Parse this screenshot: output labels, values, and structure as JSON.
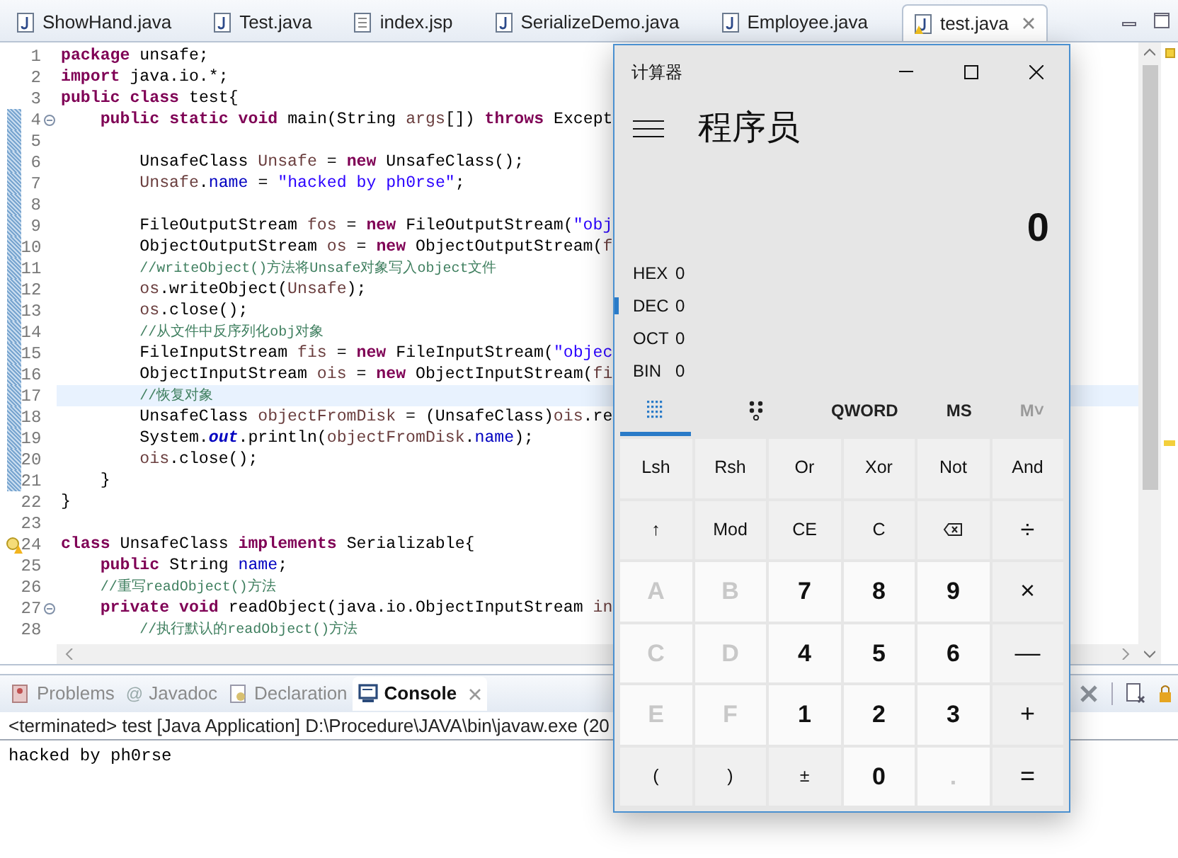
{
  "editor_tabs": [
    {
      "label": "ShowHand.java",
      "kind": "java",
      "selected": false,
      "warning": false
    },
    {
      "label": "Test.java",
      "kind": "java",
      "selected": false,
      "warning": false
    },
    {
      "label": "index.jsp",
      "kind": "jsp",
      "selected": false,
      "warning": false
    },
    {
      "label": "SerializeDemo.java",
      "kind": "java",
      "selected": false,
      "warning": false
    },
    {
      "label": "Employee.java",
      "kind": "java",
      "selected": false,
      "warning": false
    },
    {
      "label": "test.java",
      "kind": "java",
      "selected": true,
      "warning": true
    }
  ],
  "code_lines": [
    {
      "number": "1",
      "tokens": [
        {
          "text": "package",
          "kind": "k"
        },
        {
          "text": " unsafe;",
          "kind": "p"
        }
      ]
    },
    {
      "number": "2",
      "tokens": [
        {
          "text": "import",
          "kind": "k"
        },
        {
          "text": " java.io.*;",
          "kind": "p"
        }
      ]
    },
    {
      "number": "3",
      "tokens": [
        {
          "text": "public",
          "kind": "k"
        },
        {
          "text": " class",
          "kind": "k"
        },
        {
          "text": " test{",
          "kind": "p"
        }
      ]
    },
    {
      "number": "4",
      "fold": true,
      "changed": true,
      "tokens": [
        {
          "text": "    public",
          "kind": "k"
        },
        {
          "text": " static",
          "kind": "k"
        },
        {
          "text": " void",
          "kind": "k"
        },
        {
          "text": " main(String ",
          "kind": "p"
        },
        {
          "text": "args",
          "kind": "v"
        },
        {
          "text": "[]) ",
          "kind": "p"
        },
        {
          "text": "throws",
          "kind": "k"
        },
        {
          "text": " Except",
          "kind": "p"
        }
      ]
    },
    {
      "number": "5",
      "changed": true
    },
    {
      "number": "6",
      "changed": true,
      "tokens": [
        {
          "text": "        UnsafeClass ",
          "kind": "p"
        },
        {
          "text": "Unsafe",
          "kind": "v"
        },
        {
          "text": " = ",
          "kind": "p"
        },
        {
          "text": "new",
          "kind": "k"
        },
        {
          "text": " UnsafeClass();",
          "kind": "p"
        }
      ]
    },
    {
      "number": "7",
      "changed": true,
      "tokens": [
        {
          "text": "        Unsafe",
          "kind": "v"
        },
        {
          "text": ".",
          "kind": "p"
        },
        {
          "text": "name",
          "kind": "f"
        },
        {
          "text": " = ",
          "kind": "p"
        },
        {
          "text": "\"hacked by ph0rse\"",
          "kind": "s"
        },
        {
          "text": ";",
          "kind": "p"
        }
      ]
    },
    {
      "number": "8",
      "changed": true
    },
    {
      "number": "9",
      "changed": true,
      "tokens": [
        {
          "text": "        FileOutputStream ",
          "kind": "p"
        },
        {
          "text": "fos",
          "kind": "v"
        },
        {
          "text": " = ",
          "kind": "p"
        },
        {
          "text": "new",
          "kind": "k"
        },
        {
          "text": " FileOutputStream(",
          "kind": "p"
        },
        {
          "text": "\"obj",
          "kind": "s"
        }
      ]
    },
    {
      "number": "10",
      "changed": true,
      "tokens": [
        {
          "text": "        ObjectOutputStream ",
          "kind": "p"
        },
        {
          "text": "os",
          "kind": "v"
        },
        {
          "text": " = ",
          "kind": "p"
        },
        {
          "text": "new",
          "kind": "k"
        },
        {
          "text": " ObjectOutputStream(",
          "kind": "p"
        },
        {
          "text": "f",
          "kind": "v"
        }
      ]
    },
    {
      "number": "11",
      "changed": true,
      "tokens": [
        {
          "text": "        //writeObject()方法将Unsafe对象写入object文件",
          "kind": "c"
        }
      ]
    },
    {
      "number": "12",
      "changed": true,
      "tokens": [
        {
          "text": "        os",
          "kind": "v"
        },
        {
          "text": ".writeObject(",
          "kind": "p"
        },
        {
          "text": "Unsafe",
          "kind": "v"
        },
        {
          "text": ");",
          "kind": "p"
        }
      ]
    },
    {
      "number": "13",
      "changed": true,
      "tokens": [
        {
          "text": "        os",
          "kind": "v"
        },
        {
          "text": ".close();",
          "kind": "p"
        }
      ]
    },
    {
      "number": "14",
      "changed": true,
      "tokens": [
        {
          "text": "        //从文件中反序列化obj对象",
          "kind": "c"
        }
      ]
    },
    {
      "number": "15",
      "changed": true,
      "tokens": [
        {
          "text": "        FileInputStream ",
          "kind": "p"
        },
        {
          "text": "fis",
          "kind": "v"
        },
        {
          "text": " = ",
          "kind": "p"
        },
        {
          "text": "new",
          "kind": "k"
        },
        {
          "text": " FileInputStream(",
          "kind": "p"
        },
        {
          "text": "\"objec",
          "kind": "s"
        }
      ]
    },
    {
      "number": "16",
      "changed": true,
      "tokens": [
        {
          "text": "        ObjectInputStream ",
          "kind": "p"
        },
        {
          "text": "ois",
          "kind": "v"
        },
        {
          "text": " = ",
          "kind": "p"
        },
        {
          "text": "new",
          "kind": "k"
        },
        {
          "text": " ObjectInputStream(",
          "kind": "p"
        },
        {
          "text": "fi",
          "kind": "v"
        }
      ]
    },
    {
      "number": "17",
      "changed": true,
      "current": true,
      "tokens": [
        {
          "text": "        //恢复对象",
          "kind": "c"
        }
      ]
    },
    {
      "number": "18",
      "changed": true,
      "tokens": [
        {
          "text": "        UnsafeClass ",
          "kind": "p"
        },
        {
          "text": "objectFromDisk",
          "kind": "v"
        },
        {
          "text": " = (UnsafeClass)",
          "kind": "p"
        },
        {
          "text": "ois",
          "kind": "v"
        },
        {
          "text": ".re",
          "kind": "p"
        }
      ]
    },
    {
      "number": "19",
      "changed": true,
      "tokens": [
        {
          "text": "        System.",
          "kind": "p"
        },
        {
          "text": "out",
          "kind": "sf"
        },
        {
          "text": ".println(",
          "kind": "p"
        },
        {
          "text": "objectFromDisk",
          "kind": "v"
        },
        {
          "text": ".",
          "kind": "p"
        },
        {
          "text": "name",
          "kind": "f"
        },
        {
          "text": ");",
          "kind": "p"
        }
      ]
    },
    {
      "number": "20",
      "changed": true,
      "tokens": [
        {
          "text": "        ois",
          "kind": "v"
        },
        {
          "text": ".close();",
          "kind": "p"
        }
      ]
    },
    {
      "number": "21",
      "changed": true,
      "tokens": [
        {
          "text": "    }",
          "kind": "p"
        }
      ]
    },
    {
      "number": "22",
      "tokens": [
        {
          "text": "}",
          "kind": "p"
        }
      ]
    },
    {
      "number": "23"
    },
    {
      "number": "24",
      "warning": true,
      "tokens": [
        {
          "text": "class",
          "kind": "k"
        },
        {
          "text": " UnsafeClass ",
          "kind": "p"
        },
        {
          "text": "implements",
          "kind": "k"
        },
        {
          "text": " Serializable{",
          "kind": "p"
        }
      ]
    },
    {
      "number": "25",
      "tokens": [
        {
          "text": "    public",
          "kind": "k"
        },
        {
          "text": " String ",
          "kind": "p"
        },
        {
          "text": "name",
          "kind": "f"
        },
        {
          "text": ";",
          "kind": "p"
        }
      ]
    },
    {
      "number": "26",
      "tokens": [
        {
          "text": "    //重写readObject()方法",
          "kind": "c"
        }
      ]
    },
    {
      "number": "27",
      "fold": true,
      "tokens": [
        {
          "text": "    private",
          "kind": "k"
        },
        {
          "text": " void",
          "kind": "k"
        },
        {
          "text": " readObject(java.io.ObjectInputStream ",
          "kind": "p"
        },
        {
          "text": "in",
          "kind": "v"
        }
      ]
    },
    {
      "number": "28",
      "tokens": [
        {
          "text": "        //执行默认的readObject()方法",
          "kind": "c"
        }
      ]
    }
  ],
  "panel_tabs": [
    {
      "label": "Problems",
      "kind": "problems",
      "selected": false
    },
    {
      "label": "Javadoc",
      "kind": "javadoc",
      "icon": "@",
      "selected": false
    },
    {
      "label": "Declaration",
      "kind": "declaration",
      "selected": false
    },
    {
      "label": "Console",
      "kind": "console",
      "selected": true
    }
  ],
  "console": {
    "header": "<terminated> test [Java Application] D:\\Procedure\\JAVA\\bin\\javaw.exe (20",
    "output": "hacked by ph0rse"
  },
  "calculator": {
    "title": "计算器",
    "mode": "程序员",
    "display": "0",
    "radix": [
      {
        "name": "HEX",
        "value": "0",
        "selected": false
      },
      {
        "name": "DEC",
        "value": "0",
        "selected": true
      },
      {
        "name": "OCT",
        "value": "0",
        "selected": false
      },
      {
        "name": "BIN",
        "value": "0",
        "selected": false
      }
    ],
    "tabs": [
      {
        "kind": "keypad",
        "selected": true
      },
      {
        "kind": "bits",
        "selected": false
      },
      {
        "kind": "text",
        "label": "QWORD",
        "selected": false
      },
      {
        "kind": "text",
        "label": "MS",
        "selected": false
      },
      {
        "kind": "text",
        "label": "M˅",
        "selected": false,
        "disabled": true
      }
    ],
    "keys": [
      {
        "label": "Lsh",
        "kind": "func"
      },
      {
        "label": "Rsh",
        "kind": "func"
      },
      {
        "label": "Or",
        "kind": "func"
      },
      {
        "label": "Xor",
        "kind": "func"
      },
      {
        "label": "Not",
        "kind": "func"
      },
      {
        "label": "And",
        "kind": "func"
      },
      {
        "label": "↑",
        "kind": "func"
      },
      {
        "label": "Mod",
        "kind": "func"
      },
      {
        "label": "CE",
        "kind": "func"
      },
      {
        "label": "C",
        "kind": "func"
      },
      {
        "kind": "backspace"
      },
      {
        "label": "÷",
        "kind": "op"
      },
      {
        "label": "A",
        "kind": "digit",
        "disabled": true
      },
      {
        "label": "B",
        "kind": "digit",
        "disabled": true
      },
      {
        "label": "7",
        "kind": "digit"
      },
      {
        "label": "8",
        "kind": "digit"
      },
      {
        "label": "9",
        "kind": "digit"
      },
      {
        "label": "×",
        "kind": "op"
      },
      {
        "label": "C",
        "kind": "digit",
        "disabled": true
      },
      {
        "label": "D",
        "kind": "digit",
        "disabled": true
      },
      {
        "label": "4",
        "kind": "digit"
      },
      {
        "label": "5",
        "kind": "digit"
      },
      {
        "label": "6",
        "kind": "digit"
      },
      {
        "label": "—",
        "kind": "op"
      },
      {
        "label": "E",
        "kind": "digit",
        "disabled": true
      },
      {
        "label": "F",
        "kind": "digit",
        "disabled": true
      },
      {
        "label": "1",
        "kind": "digit"
      },
      {
        "label": "2",
        "kind": "digit"
      },
      {
        "label": "3",
        "kind": "digit"
      },
      {
        "label": "+",
        "kind": "op"
      },
      {
        "label": "(",
        "kind": "func"
      },
      {
        "label": ")",
        "kind": "func"
      },
      {
        "label": "±",
        "kind": "func"
      },
      {
        "label": "0",
        "kind": "digit"
      },
      {
        "label": ".",
        "kind": "digit",
        "disabled": true
      },
      {
        "label": "=",
        "kind": "op"
      }
    ]
  }
}
